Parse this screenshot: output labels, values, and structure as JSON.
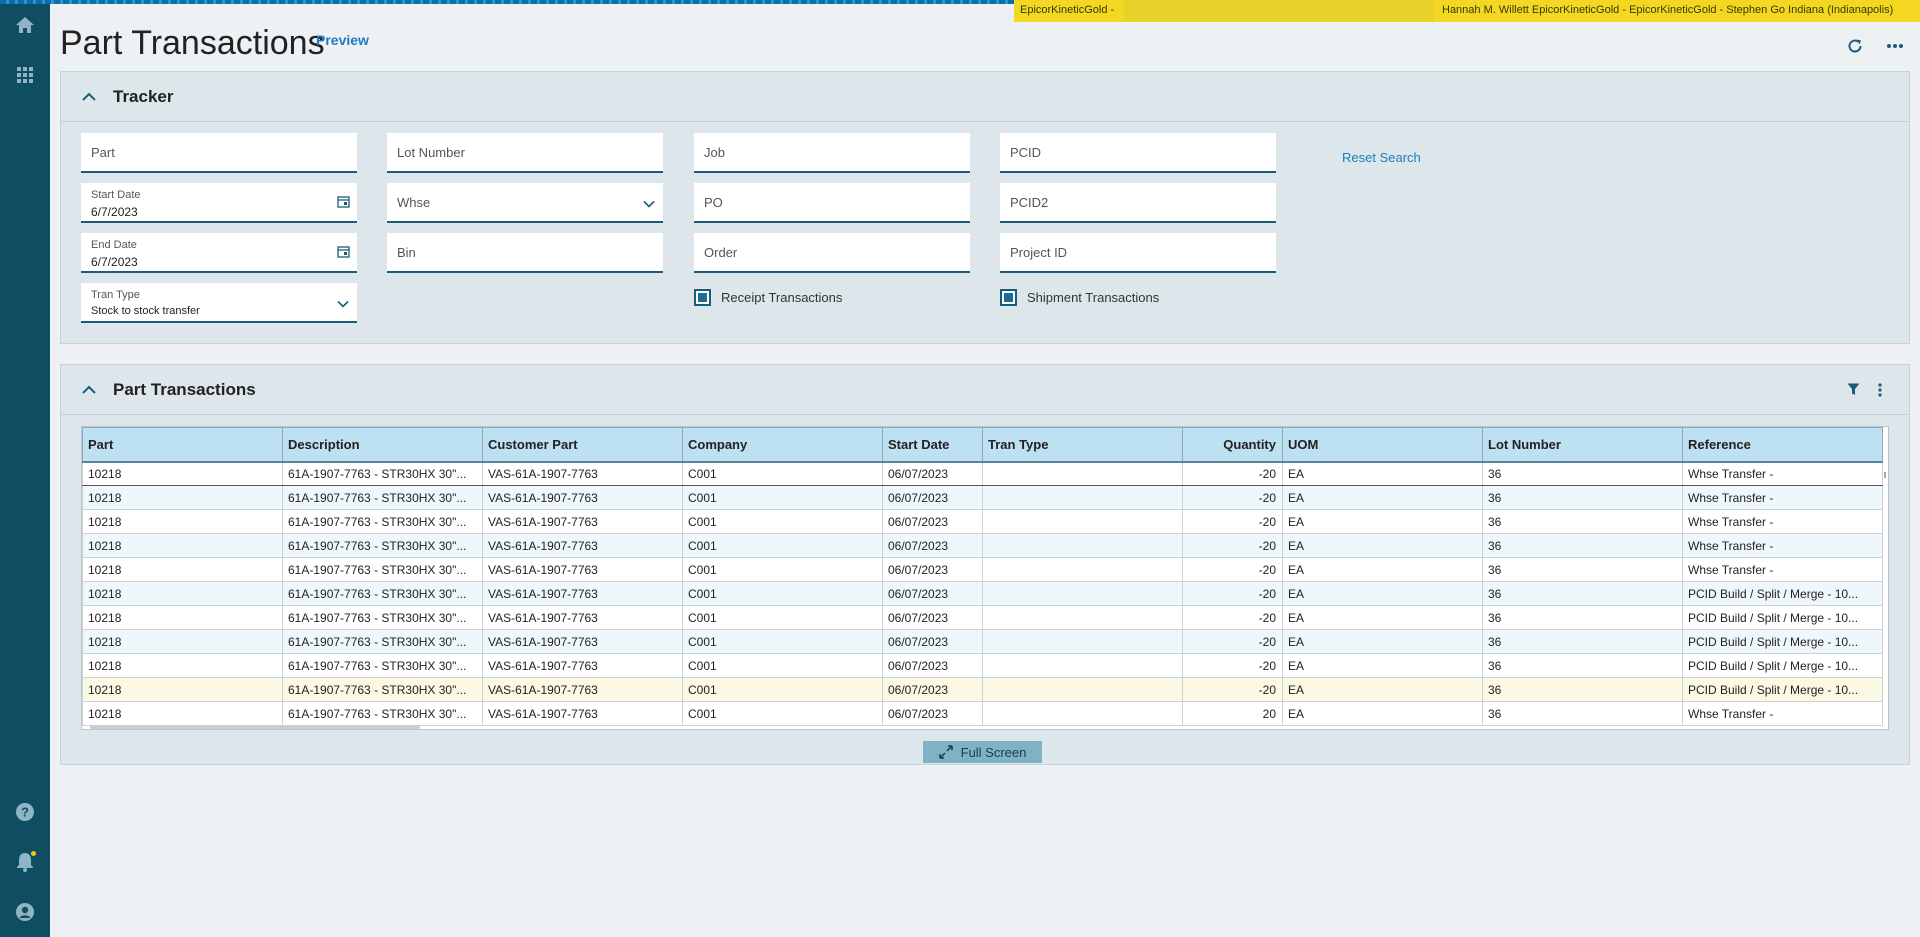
{
  "banner": {
    "left": "EpicorKineticGold -",
    "right": "Hannah M. Willett    EpicorKineticGold - EpicorKineticGold - Stephen Go    Indiana (Indianapolis)"
  },
  "nav": {
    "icons": [
      "home-icon",
      "apps-grid-icon",
      "help-icon",
      "bell-icon",
      "user-icon"
    ]
  },
  "header": {
    "title": "Part Transactions",
    "preview": "Preview"
  },
  "tracker": {
    "title": "Tracker",
    "fields": {
      "part": "Part",
      "lot_number": "Lot Number",
      "job": "Job",
      "pcid": "PCID",
      "start_date_label": "Start Date",
      "start_date_value": "6/7/2023",
      "whse": "Whse",
      "po": "PO",
      "pcid2": "PCID2",
      "end_date_label": "End Date",
      "end_date_value": "6/7/2023",
      "bin": "Bin",
      "order": "Order",
      "project_id": "Project ID",
      "tran_type_label": "Tran Type",
      "tran_type_value": "Stock to stock transfer"
    },
    "reset": "Reset Search",
    "receipt": "Receipt Transactions",
    "shipment": "Shipment Transactions"
  },
  "grid": {
    "title": "Part Transactions",
    "columns": [
      "Part",
      "Description",
      "Customer Part",
      "Company",
      "Start Date",
      "Tran Type",
      "Quantity",
      "UOM",
      "Lot Number",
      "Reference"
    ],
    "rows": [
      [
        "10218",
        "61A-1907-7763 - STR30HX 30\"...",
        "VAS-61A-1907-7763",
        "C001",
        "06/07/2023",
        "",
        "-20",
        "EA",
        "36",
        "Whse Transfer -"
      ],
      [
        "10218",
        "61A-1907-7763 - STR30HX 30\"...",
        "VAS-61A-1907-7763",
        "C001",
        "06/07/2023",
        "",
        "-20",
        "EA",
        "36",
        "Whse Transfer -"
      ],
      [
        "10218",
        "61A-1907-7763 - STR30HX 30\"...",
        "VAS-61A-1907-7763",
        "C001",
        "06/07/2023",
        "",
        "-20",
        "EA",
        "36",
        "Whse Transfer -"
      ],
      [
        "10218",
        "61A-1907-7763 - STR30HX 30\"...",
        "VAS-61A-1907-7763",
        "C001",
        "06/07/2023",
        "",
        "-20",
        "EA",
        "36",
        "Whse Transfer -"
      ],
      [
        "10218",
        "61A-1907-7763 - STR30HX 30\"...",
        "VAS-61A-1907-7763",
        "C001",
        "06/07/2023",
        "",
        "-20",
        "EA",
        "36",
        "Whse Transfer -"
      ],
      [
        "10218",
        "61A-1907-7763 - STR30HX 30\"...",
        "VAS-61A-1907-7763",
        "C001",
        "06/07/2023",
        "",
        "-20",
        "EA",
        "36",
        "PCID Build / Split / Merge - 10..."
      ],
      [
        "10218",
        "61A-1907-7763 - STR30HX 30\"...",
        "VAS-61A-1907-7763",
        "C001",
        "06/07/2023",
        "",
        "-20",
        "EA",
        "36",
        "PCID Build / Split / Merge - 10..."
      ],
      [
        "10218",
        "61A-1907-7763 - STR30HX 30\"...",
        "VAS-61A-1907-7763",
        "C001",
        "06/07/2023",
        "",
        "-20",
        "EA",
        "36",
        "PCID Build / Split / Merge - 10..."
      ],
      [
        "10218",
        "61A-1907-7763 - STR30HX 30\"...",
        "VAS-61A-1907-7763",
        "C001",
        "06/07/2023",
        "",
        "-20",
        "EA",
        "36",
        "PCID Build / Split / Merge - 10..."
      ],
      [
        "10218",
        "61A-1907-7763 - STR30HX 30\"...",
        "VAS-61A-1907-7763",
        "C001",
        "06/07/2023",
        "",
        "-20",
        "EA",
        "36",
        "PCID Build / Split / Merge - 10..."
      ],
      [
        "10218",
        "61A-1907-7763 - STR30HX 30\"...",
        "VAS-61A-1907-7763",
        "C001",
        "06/07/2023",
        "",
        "20",
        "EA",
        "36",
        "Whse Transfer -"
      ]
    ],
    "highlight_row": 9
  },
  "fullscreen": "Full Screen",
  "colors": {
    "nav": "#0f4d63",
    "accent": "#1c7ec0",
    "header_row": "#bde0f3",
    "banner": "#f4d723"
  }
}
